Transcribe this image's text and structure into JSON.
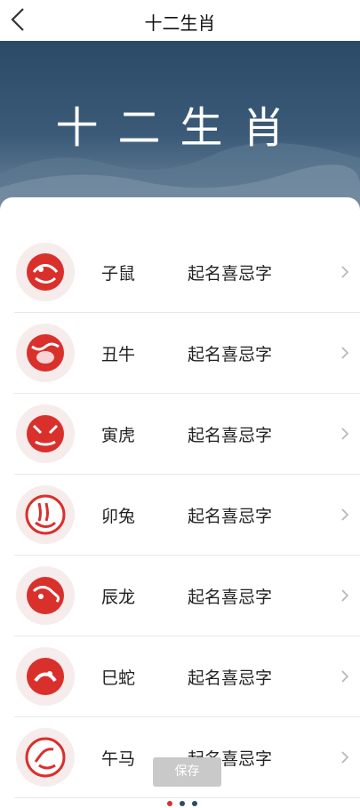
{
  "header": {
    "title": "十二生肖"
  },
  "banner": {
    "text": "十二生肖"
  },
  "zodiac": [
    {
      "name": "子鼠",
      "desc": "起名喜忌字"
    },
    {
      "name": "丑牛",
      "desc": "起名喜忌字"
    },
    {
      "name": "寅虎",
      "desc": "起名喜忌字"
    },
    {
      "name": "卯兔",
      "desc": "起名喜忌字"
    },
    {
      "name": "辰龙",
      "desc": "起名喜忌字"
    },
    {
      "name": "巳蛇",
      "desc": "起名喜忌字"
    },
    {
      "name": "午马",
      "desc": "起名喜忌字"
    }
  ],
  "footer": {
    "save_label": "保存"
  },
  "pager": {
    "colors": [
      "#d9302c",
      "#2b4a66",
      "#2b4a66"
    ]
  },
  "colors": {
    "banner": "#2b4a66",
    "accent": "#d9302c"
  }
}
